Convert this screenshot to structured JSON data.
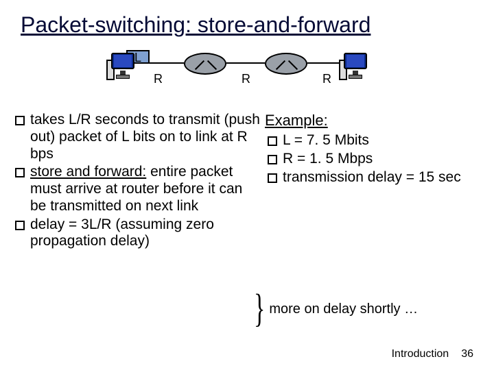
{
  "title": "Packet-switching: store-and-forward",
  "diagram": {
    "packet_label": "L",
    "link_labels": [
      "R",
      "R",
      "R"
    ]
  },
  "left_bullets": [
    {
      "text": "takes L/R seconds to transmit (push out) packet of L bits on to link at R bps"
    },
    {
      "prefix": "store and forward:",
      "text": " entire packet must arrive at router before it can be transmitted on next link"
    },
    {
      "text": "delay = 3L/R (assuming zero propagation delay)"
    }
  ],
  "example": {
    "heading": "Example:",
    "bullets": [
      "L = 7. 5 Mbits",
      "R = 1. 5 Mbps",
      "transmission delay = 15 sec"
    ]
  },
  "note": "more on delay shortly …",
  "footer": {
    "chapter": "Introduction",
    "page": "36"
  }
}
